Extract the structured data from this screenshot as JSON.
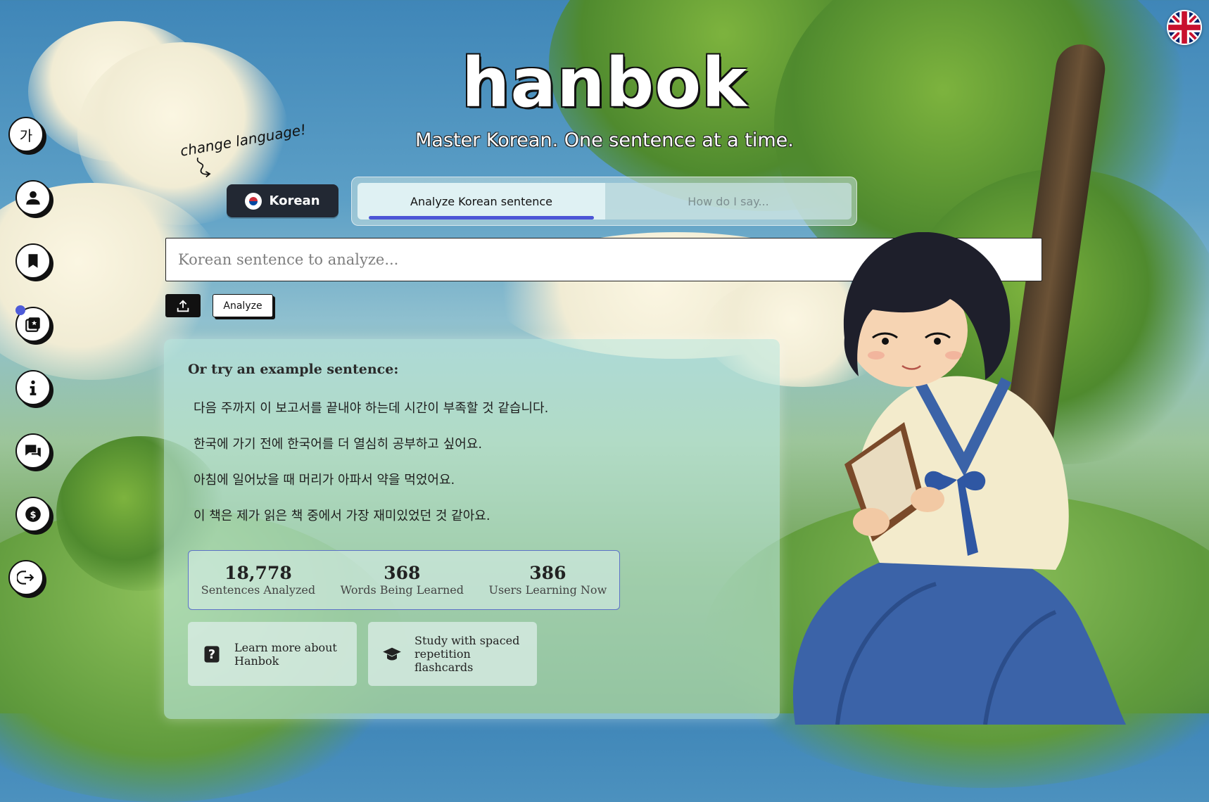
{
  "app": {
    "title": "hanbok",
    "tagline": "Master Korean. One sentence at a time."
  },
  "ui_language_flag": "uk-flag-icon",
  "sidebar": {
    "items": [
      {
        "name": "hangul-icon",
        "glyph": "가"
      },
      {
        "name": "profile-icon"
      },
      {
        "name": "bookmark-icon"
      },
      {
        "name": "flashcards-icon",
        "has_notification": true
      },
      {
        "name": "info-icon"
      },
      {
        "name": "chat-icon"
      },
      {
        "name": "pricing-icon"
      },
      {
        "name": "logout-icon"
      }
    ]
  },
  "language_selector": {
    "hint": "change language!",
    "label": "Korean",
    "flag": "korea-flag-icon"
  },
  "mode_tabs": [
    {
      "label": "Analyze Korean sentence",
      "active": true
    },
    {
      "label": "How do I say...",
      "active": false
    }
  ],
  "search": {
    "placeholder": "Korean sentence to analyze...",
    "value": ""
  },
  "actions": {
    "analyze_label": "Analyze"
  },
  "examples": {
    "heading": "Or try an example sentence:",
    "sentences": [
      "다음 주까지 이 보고서를 끝내야 하는데 시간이 부족할 것 같습니다.",
      "한국에 가기 전에 한국어를 더 열심히 공부하고 싶어요.",
      "아침에 일어났을 때 머리가 아파서 약을 먹었어요.",
      "이 책은 제가 읽은 책 중에서 가장 재미있었던 것 같아요."
    ]
  },
  "stats": [
    {
      "value": "18,778",
      "label": "Sentences Analyzed"
    },
    {
      "value": "368",
      "label": "Words Being Learned"
    },
    {
      "value": "386",
      "label": "Users Learning Now"
    }
  ],
  "cards": [
    {
      "label": "Learn more about Hanbok",
      "icon": "question-icon"
    },
    {
      "label": "Study with spaced repetition flashcards",
      "icon": "graduation-cap-icon"
    }
  ],
  "colors": {
    "accent": "#4c55d6",
    "stats_border": "#5d72c8",
    "dark_button": "#222833"
  }
}
